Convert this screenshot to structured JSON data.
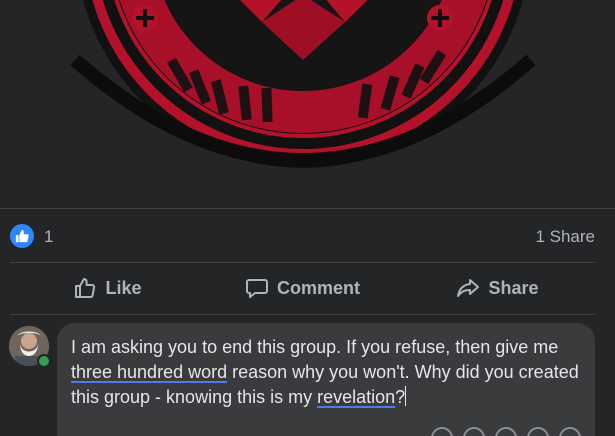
{
  "post": {
    "reactions": {
      "count": "1",
      "icon": "like-icon",
      "shares": "1 Share"
    },
    "actions": {
      "like_label": "Like",
      "comment_label": "Comment",
      "share_label": "Share"
    }
  },
  "comment": {
    "avatar": "user-avatar",
    "online": true,
    "text_parts": {
      "p1": "I am asking you to end this group. If you refuse, then give me ",
      "p2": "three hundred word",
      "p3": " reason why you won't. Why did you created this group - knowing this is my ",
      "p4": "revelation",
      "p5": "?"
    }
  },
  "colors": {
    "background": "#242526",
    "accent": "#2d88ff",
    "emblem_red": "#c8102e",
    "online": "#31a24c"
  }
}
